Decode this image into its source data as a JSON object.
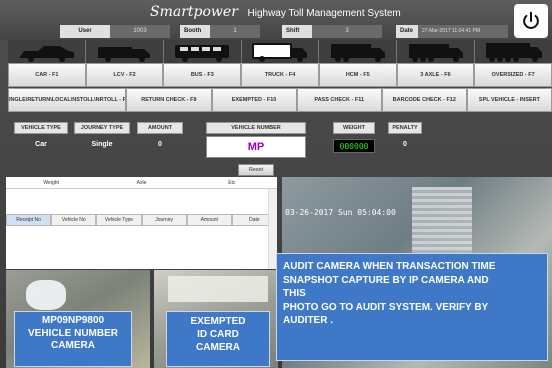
{
  "header": {
    "logo_text": "Smartpower",
    "title": "Highway Toll Management System",
    "info": [
      {
        "label": "User",
        "value": "1003"
      },
      {
        "label": "Booth",
        "value": "1"
      },
      {
        "label": "Shift",
        "value": "3"
      },
      {
        "label": "Date",
        "value": "27-Mar-2017 11:04:41 PM"
      }
    ],
    "power_icon": "power-icon"
  },
  "vehicle_icons": [
    "car-icon",
    "lcv-icon",
    "bus-icon",
    "truck-icon",
    "hcm-icon",
    "3-axle-icon",
    "oversized-icon"
  ],
  "categories": [
    "CAR - F1",
    "LCV - F2",
    "BUS - F3",
    "TRUCK - F4",
    "HCM - F5",
    "3 AXLE - F6",
    "OVERSIZED - F7"
  ],
  "actions": [
    "SINGLE\\RETURN\\LOCAL\\NSTOLL\\NRTOLL - F8",
    "RETURN CHECK - F9",
    "EXEMPTED - F10",
    "PASS CHECK - F11",
    "BARCODE CHECK - F12",
    "SPL VEHICLE - INSERT"
  ],
  "form": {
    "vehicle_type_label": "VEHICLE TYPE",
    "vehicle_type_value": "Car",
    "journey_type_label": "JOURNEY TYPE",
    "journey_type_value": "Single",
    "amount_label": "AMOUNT",
    "amount_value": "0",
    "vehicle_number_label": "VEHICLE NUMBER",
    "vehicle_number_value": "MP",
    "weight_label": "WEIGHT",
    "weight_value": "000000",
    "penalty_label": "PENALTY",
    "penalty_value": "0",
    "reset_label": "Reset"
  },
  "grid": {
    "top_headers": [
      "Weight",
      "Axle",
      "Etc"
    ],
    "columns": [
      "Receipt No",
      "Vehicle No",
      "Vehicle Type",
      "Journey",
      "Amount",
      "Date"
    ]
  },
  "camera": {
    "timestamp": "03-26-2017 Sun 05:04:00"
  },
  "notes": {
    "vehicle_cam": [
      "MP09NP9800",
      "VEHICLE NUMBER",
      "CAMERA"
    ],
    "id_cam": [
      "EXEMPTED",
      "ID CARD",
      "CAMERA"
    ],
    "audit": [
      "AUDIT CAMERA WHEN TRANSACTION TIME",
      "SNAPSHOT CAPTURE BY IP CAMERA AND",
      "THIS",
      "PHOTO GO TO AUDIT SYSTEM. VERIFY BY",
      "AUDITER ."
    ]
  }
}
